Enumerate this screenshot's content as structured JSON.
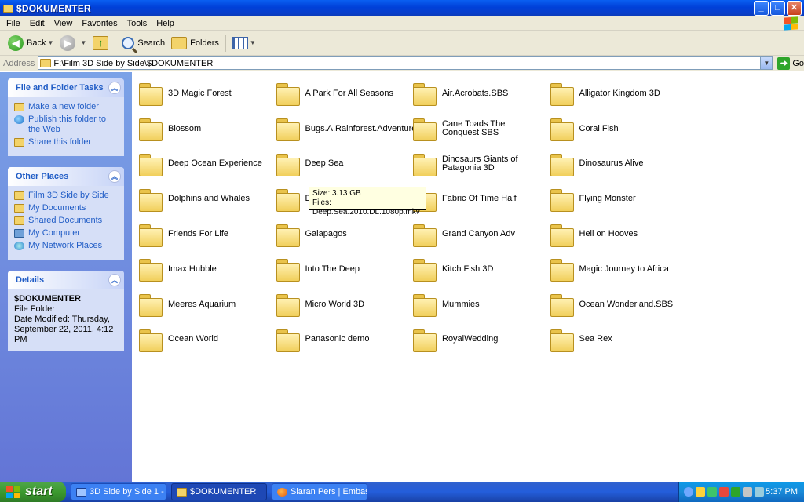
{
  "window": {
    "title": "$DOKUMENTER",
    "minimize": "_",
    "maximize": "□",
    "close": "✕"
  },
  "menu": [
    "File",
    "Edit",
    "View",
    "Favorites",
    "Tools",
    "Help"
  ],
  "toolbar": {
    "back": "Back",
    "search": "Search",
    "folders": "Folders"
  },
  "address": {
    "label": "Address",
    "path": "F:\\Film 3D Side by Side\\$DOKUMENTER",
    "go": "Go"
  },
  "sidebar": {
    "tasks": {
      "title": "File and Folder Tasks",
      "items": [
        "Make a new folder",
        "Publish this folder to the Web",
        "Share this folder"
      ]
    },
    "places": {
      "title": "Other Places",
      "items": [
        "Film 3D Side by Side",
        "My Documents",
        "Shared Documents",
        "My Computer",
        "My Network Places"
      ]
    },
    "details": {
      "title": "Details",
      "name": "$DOKUMENTER",
      "type": "File Folder",
      "modified": "Date Modified: Thursday, September 22, 2011, 4:12 PM"
    }
  },
  "folders": [
    "3D Magic Forest",
    "A Park For All Seasons",
    "Air.Acrobats.SBS",
    "Alligator Kingdom 3D",
    "Blossom",
    "Bugs.A.Rainforest.Adventure",
    "Cane Toads The Conquest SBS",
    "Coral Fish",
    "Deep Ocean Experience",
    "Deep Sea",
    "Dinosaurs Giants of Patagonia 3D",
    "Dinosaurus Alive",
    "Dolphins and Whales",
    "D",
    "Fabric Of Time Half",
    "Flying Monster",
    "Friends For Life",
    "Galapagos",
    "Grand Canyon Adv",
    "Hell on Hooves",
    "Imax Hubble",
    "Into The Deep",
    "Kitch Fish 3D",
    "Magic Journey to Africa",
    "Meeres Aquarium",
    "Micro World 3D",
    "Mummies",
    "Ocean Wonderland.SBS",
    "Ocean World",
    "Panasonic demo",
    "RoyalWedding",
    "Sea Rex"
  ],
  "tooltip": {
    "size": "Size: 3.13 GB",
    "files": "Files: Deep.Sea.2010.DL.1080p.mkv"
  },
  "taskbar": {
    "start": "start",
    "buttons": [
      "3D Side by Side 1 - A...",
      "$DOKUMENTER",
      "Siaran Pers | Embass..."
    ],
    "clock": "5:37 PM"
  }
}
